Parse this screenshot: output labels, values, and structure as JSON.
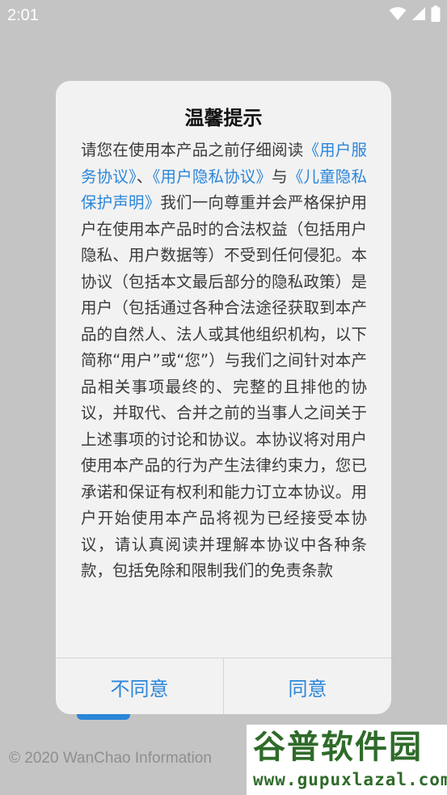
{
  "status_bar": {
    "time": "2:01",
    "icons": [
      "wifi-icon",
      "signal-icon",
      "battery-icon"
    ]
  },
  "background": {
    "copyright": "© 2020 WanChao Information"
  },
  "dialog": {
    "title": "温馨提示",
    "body": {
      "intro": "请您在使用本产品之前仔细阅读",
      "link_user_service": "《用户服务协议》",
      "sep1": "、",
      "link_privacy": "《用户隐私协议》",
      "sep2": "与",
      "link_child_privacy": "《儿童隐私保护声明》",
      "text": "我们一向尊重并会严格保护用户在使用本产品时的合法权益（包括用户隐私、用户数据等）不受到任何侵犯。本协议（包括本文最后部分的隐私政策）是用户（包括通过各种合法途径获取到本产品的自然人、法人或其他组织机构，以下简称“用户”或“您”）与我们之间针对本产品相关事项最终的、完整的且排他的协议，并取代、合并之前的当事人之间关于上述事项的讨论和协议。本协议将对用户使用本产品的行为产生法律约束力，您已承诺和保证有权利和能力订立本协议。用户开始使用本产品将视为已经接受本协议，请认真阅读并理解本协议中各种条款，包括免除和限制我们的免责条款"
    },
    "disagree_label": "不同意",
    "agree_label": "同意"
  },
  "watermark": {
    "logo": "谷普软件园",
    "url": "www.gupuxlazal.com"
  },
  "colors": {
    "link": "#2b86d9",
    "dim_background": "#c4c4c4",
    "dialog_background": "#f2f2f2",
    "watermark_green": "#2f6b2a"
  }
}
